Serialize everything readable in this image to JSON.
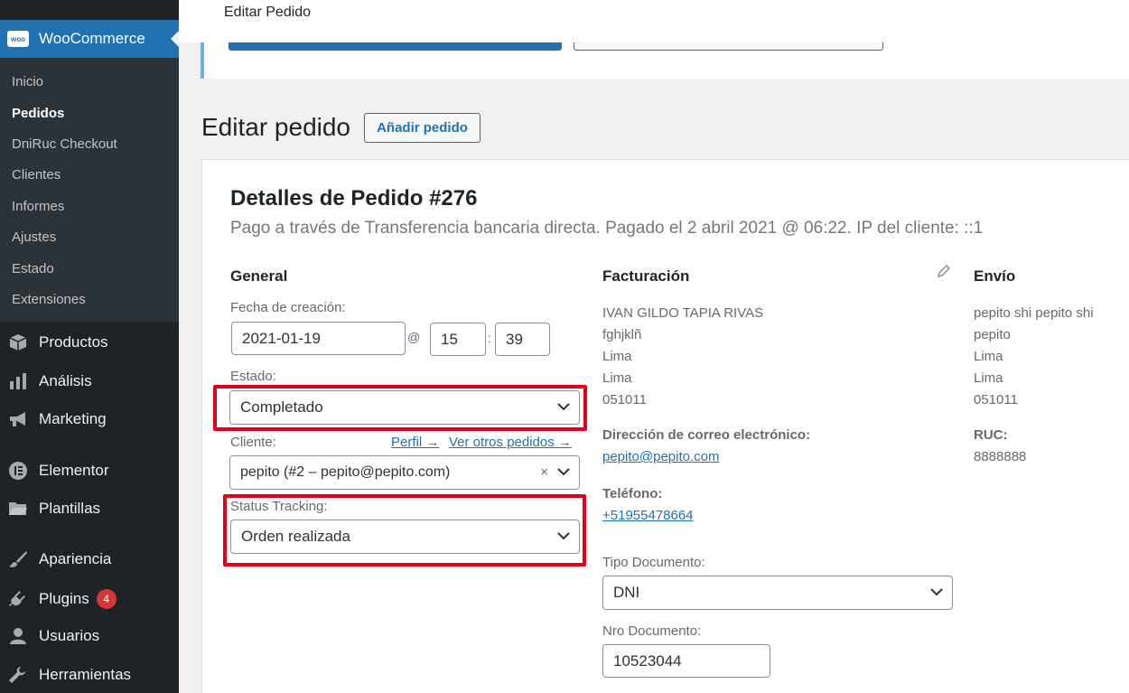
{
  "topbar": {
    "title": "Editar Pedido"
  },
  "sidebar": {
    "woocommerce_label": "WooCommerce",
    "logo_text": "woo",
    "submenu": [
      "Inicio",
      "Pedidos",
      "DniRuc Checkout",
      "Clientes",
      "Informes",
      "Ajustes",
      "Estado",
      "Extensiones"
    ],
    "active_submenu": "Pedidos",
    "menu": [
      {
        "label": "Productos",
        "icon": "archive-icon"
      },
      {
        "label": "Análisis",
        "icon": "bar-chart-icon"
      },
      {
        "label": "Marketing",
        "icon": "megaphone-icon"
      },
      {
        "label": "Elementor",
        "icon": "elementor-icon"
      },
      {
        "label": "Plantillas",
        "icon": "folder-icon"
      },
      {
        "label": "Apariencia",
        "icon": "brush-icon"
      },
      {
        "label": "Plugins",
        "icon": "plug-icon",
        "badge": "4"
      },
      {
        "label": "Usuarios",
        "icon": "user-icon"
      },
      {
        "label": "Herramientas",
        "icon": "wrench-icon"
      }
    ]
  },
  "page": {
    "title": "Editar pedido",
    "add_button": "Añadir pedido"
  },
  "order": {
    "title": "Detalles de Pedido #276",
    "meta": "Pago a través de Transferencia bancaria directa. Pagado el 2 abril 2021 @ 06:22. IP del cliente: ::1"
  },
  "general": {
    "heading": "General",
    "date_label": "Fecha de creación:",
    "date": "2021-01-19",
    "at": "@",
    "hour": "15",
    "colon": ":",
    "minute": "39",
    "status_label": "Estado:",
    "status": "Completado",
    "customer_label": "Cliente:",
    "profile_link": "Perfil →",
    "other_orders_link": "Ver otros pedidos →",
    "customer": "pepito (#2 – pepito@pepito.com)",
    "clear": "×",
    "tracking_label": "Status Tracking:",
    "tracking": "Orden realizada"
  },
  "billing": {
    "heading": "Facturación",
    "address": [
      "IVAN GILDO TAPIA RIVAS",
      "fghjklñ",
      "Lima",
      "Lima",
      "051011"
    ],
    "email_label": "Dirección de correo electrónico:",
    "email": "pepito@pepito.com",
    "phone_label": "Teléfono:",
    "phone": "+51955478664",
    "doc_type_label": "Tipo Documento:",
    "doc_type": "DNI",
    "doc_number_label": "Nro Documento:",
    "doc_number": "10523044"
  },
  "shipping": {
    "heading": "Envío",
    "address": [
      "pepito shi pepito shi",
      "pepito",
      "Lima",
      "Lima",
      "051011"
    ],
    "ruc_label": "RUC:",
    "ruc": "8888888"
  },
  "colors": {
    "sidebar": "#1d2327",
    "accent": "#2271b1",
    "highlight": "#e0001b",
    "badge": "#d63638"
  }
}
